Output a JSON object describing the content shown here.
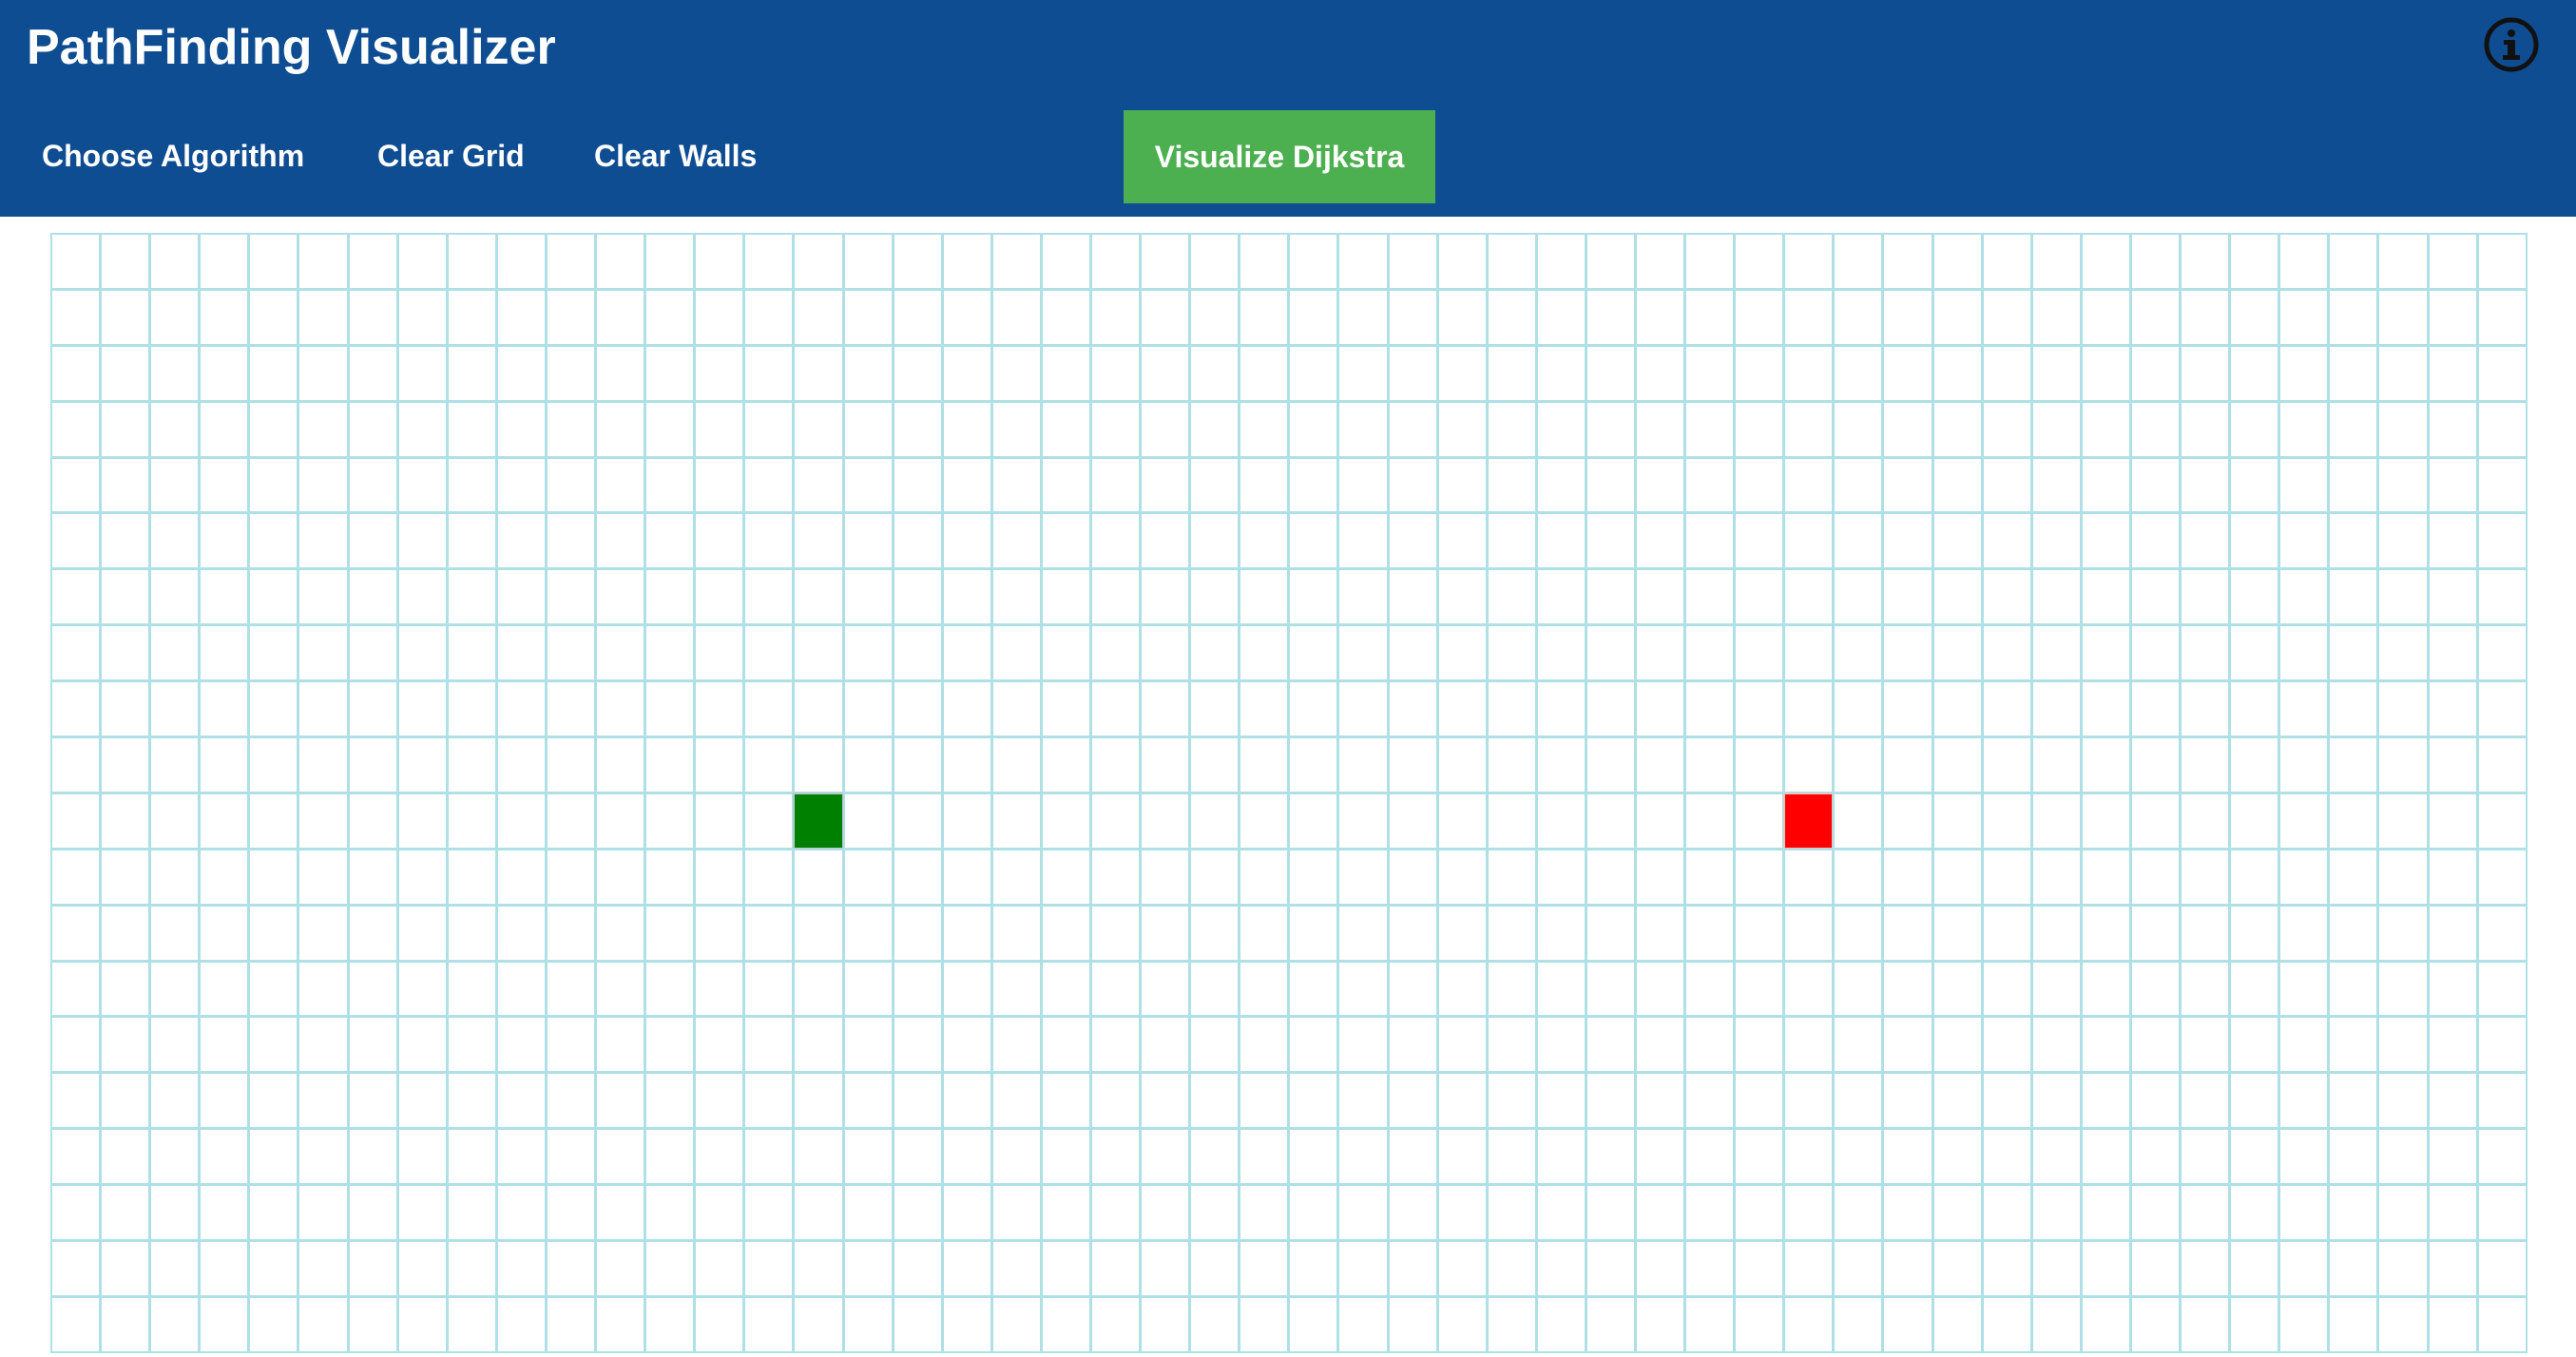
{
  "header": {
    "title": "PathFinding Visualizer",
    "background_color": "#0f4d92",
    "info_icon": "info-circle-icon"
  },
  "nav": {
    "choose_algorithm": "Choose Algorithm",
    "clear_grid": "Clear Grid",
    "clear_walls": "Clear Walls",
    "visualize": "Visualize Dijkstra",
    "visualize_color": "#4caf50"
  },
  "grid": {
    "rows": 20,
    "cols": 50,
    "start_node": {
      "row": 10,
      "col": 15,
      "color": "#008000"
    },
    "end_node": {
      "row": 10,
      "col": 35,
      "color": "#ff0000"
    },
    "cell_border_color": "#aee0e6"
  }
}
